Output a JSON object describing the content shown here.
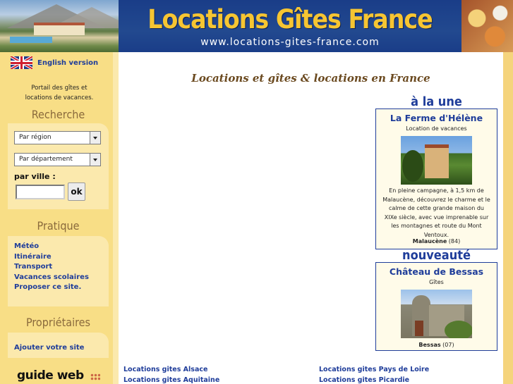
{
  "header": {
    "title": "Locations Gîtes France",
    "url": "www.locations-gites-france.com"
  },
  "sidebar": {
    "lang_link": "English version",
    "tagline_line1": "Portail des gîtes et",
    "tagline_line2": "locations de vacances.",
    "search": {
      "title": "Recherche",
      "region_select": "Par région",
      "departement_select": "Par département",
      "city_label": "par ville :",
      "city_value": "",
      "ok_label": "ok"
    },
    "pratique": {
      "title": "Pratique",
      "links": [
        "Météo",
        "Itinéraire",
        "Transport",
        "Vacances scolaires",
        "Proposer ce site."
      ]
    },
    "proprietaires": {
      "title": "Propriétaires",
      "links": [
        "Ajouter votre site"
      ]
    },
    "guideweb_logo": "guide web"
  },
  "main": {
    "title": "Locations et gîtes & locations en France",
    "a_la_une": {
      "heading": "à la une",
      "name": "La Ferme d'Hélène",
      "type": "Location de vacances",
      "description": "En pleine campagne, à 1,5 km de Malaucène, découvrez le charme et le calme de cette grande maison du XIXe siècle, avec vue imprenable sur les montagnes et route du Mont Ventoux.",
      "location_town": "Malaucène",
      "location_dept": "(84)"
    },
    "nouveaute": {
      "heading": "nouveauté",
      "name": "Château de Bessas",
      "type": "Gîtes",
      "location_town": "Bessas",
      "location_dept": "(07)"
    },
    "region_links_left": [
      "Locations gites Alsace",
      "Locations gites Aquitaine"
    ],
    "region_links_right": [
      "Locations gites Pays de Loire",
      "Locations gites Picardie"
    ]
  },
  "colors": {
    "header_blue": "#1c3f86",
    "title_gold": "#f6c532",
    "sidebar_yellow": "#f8de86",
    "link_blue": "#1f3d9a",
    "heading_brown": "#6b4a20"
  }
}
